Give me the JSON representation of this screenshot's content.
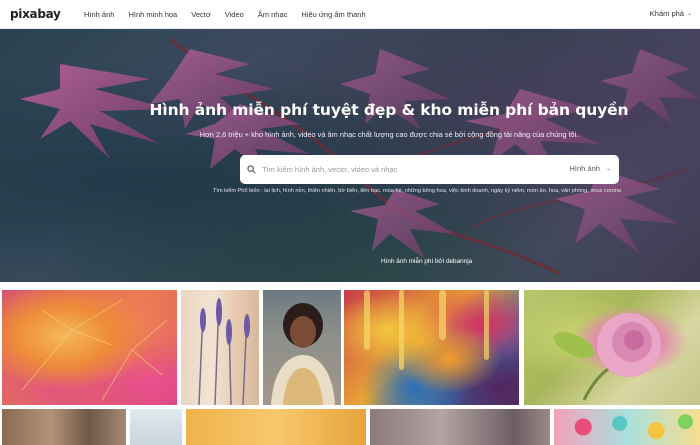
{
  "brand": {
    "logo": "pixabay"
  },
  "nav": {
    "items": [
      {
        "label": "Hình ảnh"
      },
      {
        "label": "Hình minh họa"
      },
      {
        "label": "Vectơ"
      },
      {
        "label": "Video"
      },
      {
        "label": "Âm nhạc"
      },
      {
        "label": "Hiệu ứng âm thanh"
      }
    ],
    "explore": "Khám phá"
  },
  "hero": {
    "title": "Hình ảnh miễn phí tuyệt đẹp & kho miễn phí bản quyền",
    "subtitle": "Hơn 2,6 triệu + kho hình ảnh, video và âm nhạc chất lượng cao được chia sẻ bởi cộng đồng tài năng của chúng tôi.",
    "search": {
      "placeholder": "Tìm kiếm hình ảnh, vectơ, video và nhạc",
      "type": "Hình ảnh"
    },
    "popular": "Tìm kiếm Phổ biến : lai lịch, hình nền, thiên nhiên, bờ biển, tiền bạc, mùa hè, những bông hoa, việc kinh doanh, ngày kỷ niệm, món ăn, hoa, văn phòng, virus corona",
    "credit": "Hình ảnh miễn phí bởi debannja"
  },
  "colors": {
    "hero_text": "#ffffff",
    "nav_text": "#333333",
    "search_bg": "#ffffff"
  },
  "gallery": {
    "row1": [
      {
        "name": "autumn-leaves"
      },
      {
        "name": "lavender"
      },
      {
        "name": "portrait-woman"
      },
      {
        "name": "abstract-paint"
      },
      {
        "name": "pink-rose"
      }
    ],
    "row2": [
      {
        "name": "building"
      },
      {
        "name": "sky"
      },
      {
        "name": "sunset"
      },
      {
        "name": "clouds"
      },
      {
        "name": "candy"
      }
    ]
  }
}
